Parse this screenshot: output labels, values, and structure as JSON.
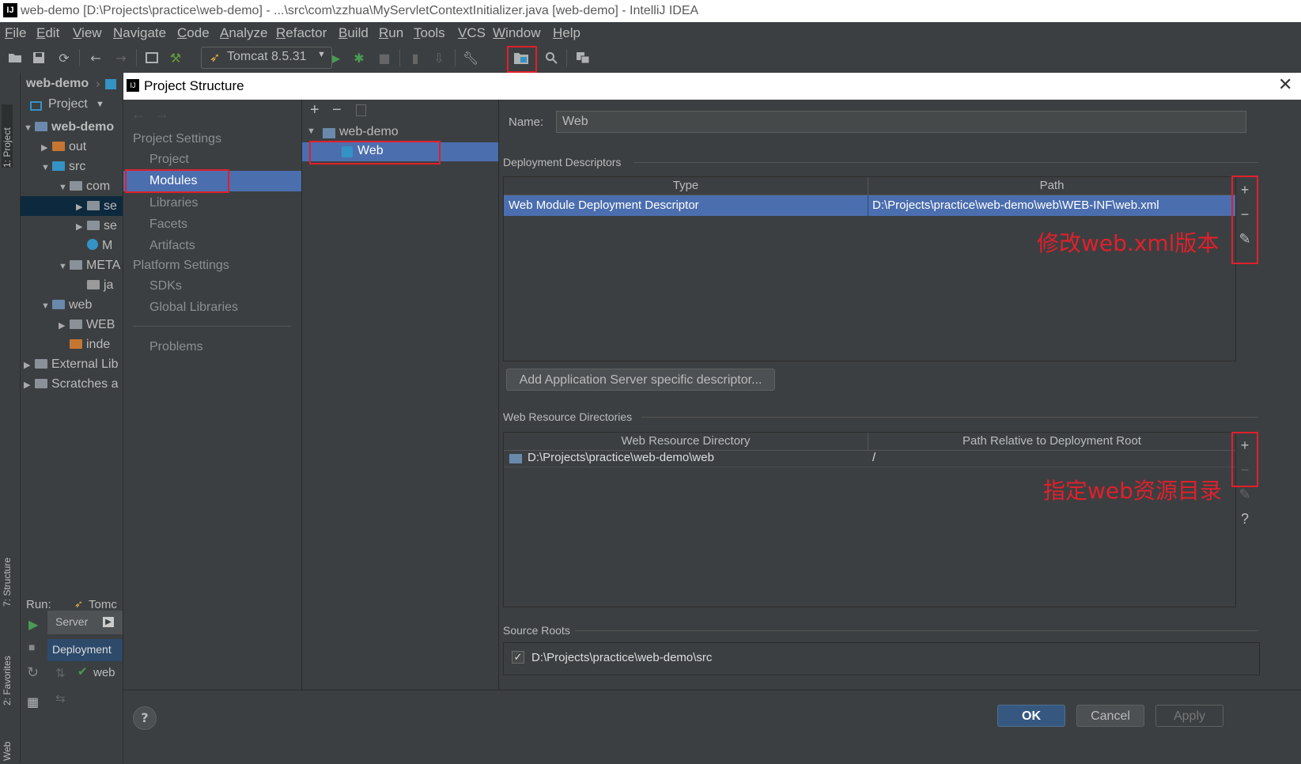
{
  "window": {
    "title": "web-demo [D:\\Projects\\practice\\web-demo] - ...\\src\\com\\zzhua\\MyServletContextInitializer.java [web-demo] - IntelliJ IDEA",
    "logo": "IJ"
  },
  "menu": [
    "File",
    "Edit",
    "View",
    "Navigate",
    "Code",
    "Analyze",
    "Refactor",
    "Build",
    "Run",
    "Tools",
    "VCS",
    "Window",
    "Help"
  ],
  "toolbar": {
    "run_config": "Tomcat 8.5.31"
  },
  "navbar": {
    "project": "web-demo"
  },
  "left_tabs": {
    "project": "1: Project",
    "structure": "7: Structure",
    "favorites": "2: Favorites",
    "web": "Web"
  },
  "project_panel": {
    "header": "Project",
    "tree": [
      {
        "label": "web-demo",
        "indent": 0,
        "arrow": "▼",
        "bold": true,
        "icon": "module"
      },
      {
        "label": "out",
        "indent": 1,
        "arrow": "▶",
        "icon": "folder-orange"
      },
      {
        "label": "src",
        "indent": 1,
        "arrow": "▼",
        "icon": "folder-blue"
      },
      {
        "label": "com",
        "indent": 2,
        "arrow": "▼",
        "icon": "package"
      },
      {
        "label": "se",
        "indent": 3,
        "arrow": "▶",
        "icon": "package",
        "selected": true
      },
      {
        "label": "se",
        "indent": 3,
        "arrow": "▶",
        "icon": "package"
      },
      {
        "label": "M",
        "indent": 3,
        "arrow": "",
        "icon": "class"
      },
      {
        "label": "META",
        "indent": 2,
        "arrow": "▼",
        "icon": "package"
      },
      {
        "label": "ja",
        "indent": 3,
        "arrow": "",
        "icon": "file"
      },
      {
        "label": "web",
        "indent": 1,
        "arrow": "▼",
        "icon": "web-folder"
      },
      {
        "label": "WEB",
        "indent": 2,
        "arrow": "▶",
        "icon": "folder"
      },
      {
        "label": "inde",
        "indent": 2,
        "arrow": "",
        "icon": "jsp"
      },
      {
        "label": "External Lib",
        "indent": 0,
        "arrow": "▶",
        "icon": "libs"
      },
      {
        "label": "Scratches a",
        "indent": 0,
        "arrow": "▶",
        "icon": "scratch"
      }
    ]
  },
  "run_panel": {
    "label": "Run:",
    "tab": "Tomc",
    "server_tab": "Server",
    "deployment_tab": "Deployment",
    "item": "web"
  },
  "dialog": {
    "title": "Project Structure",
    "project_settings_header": "Project Settings",
    "platform_settings_header": "Platform Settings",
    "project_settings": [
      "Project",
      "Modules",
      "Libraries",
      "Facets",
      "Artifacts"
    ],
    "platform_settings": [
      "SDKs",
      "Global Libraries"
    ],
    "problems": "Problems",
    "selected": "Modules",
    "modules_tree": {
      "root": "web-demo",
      "child": "Web"
    },
    "name_label": "Name:",
    "name_value": "Web",
    "deployment_descriptors": {
      "header": "Deployment Descriptors",
      "columns": [
        "Type",
        "Path"
      ],
      "rows": [
        {
          "type": "Web Module Deployment Descriptor",
          "path": "D:\\Projects\\practice\\web-demo\\web\\WEB-INF\\web.xml"
        }
      ]
    },
    "add_server_descriptor": "Add Application Server specific descriptor...",
    "web_resource_dirs": {
      "header": "Web Resource Directories",
      "columns": [
        "Web Resource Directory",
        "Path Relative to Deployment Root"
      ],
      "rows": [
        {
          "dir": "D:\\Projects\\practice\\web-demo\\web",
          "relative": "/"
        }
      ]
    },
    "source_roots": {
      "header": "Source Roots",
      "items": [
        {
          "path": "D:\\Projects\\practice\\web-demo\\src",
          "checked": true
        }
      ]
    },
    "buttons": {
      "ok": "OK",
      "cancel": "Cancel",
      "apply": "Apply",
      "help": "?"
    }
  },
  "annotations": {
    "edit_webxml": "修改web.xml版本",
    "web_resource": "指定web资源目录"
  },
  "colors": {
    "selection": "#4b6eaf",
    "annotation": "#e0202c",
    "primary_button": "#365880"
  }
}
